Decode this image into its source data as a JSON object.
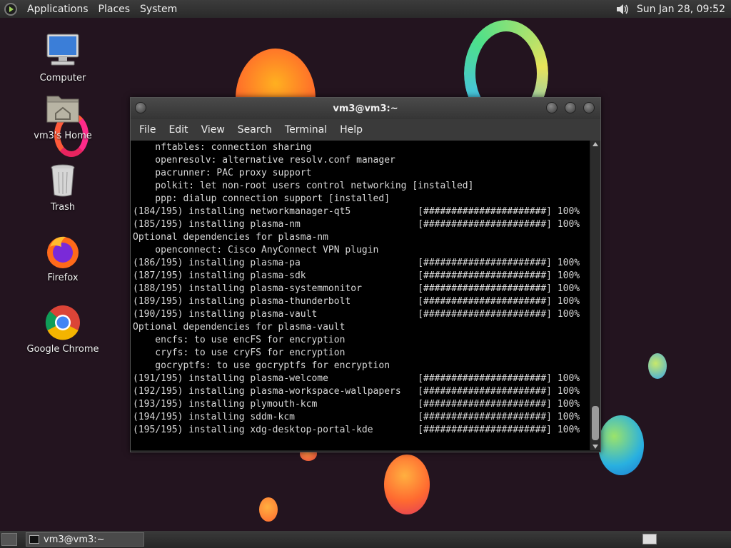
{
  "top_panel": {
    "menus": [
      "Applications",
      "Places",
      "System"
    ],
    "clock": "Sun Jan 28, 09:52",
    "icons": [
      "distro-logo-icon",
      "volume-icon"
    ]
  },
  "desktop_icons": [
    {
      "label": "Computer",
      "icon": "computer-icon"
    },
    {
      "label": "vm3's Home",
      "icon": "home-folder-icon"
    },
    {
      "label": "Trash",
      "icon": "trash-icon"
    },
    {
      "label": "Firefox",
      "icon": "firefox-icon"
    },
    {
      "label": "Google Chrome",
      "icon": "chrome-icon"
    }
  ],
  "terminal": {
    "title": "vm3@vm3:~",
    "menu": [
      "File",
      "Edit",
      "View",
      "Search",
      "Terminal",
      "Help"
    ],
    "lines": [
      "    nftables: connection sharing",
      "    openresolv: alternative resolv.conf manager",
      "    pacrunner: PAC proxy support",
      "    polkit: let non-root users control networking [installed]",
      "    ppp: dialup connection support [installed]",
      "(184/195) installing networkmanager-qt5            [######################] 100%",
      "(185/195) installing plasma-nm                     [######################] 100%",
      "Optional dependencies for plasma-nm",
      "    openconnect: Cisco AnyConnect VPN plugin",
      "(186/195) installing plasma-pa                     [######################] 100%",
      "(187/195) installing plasma-sdk                    [######################] 100%",
      "(188/195) installing plasma-systemmonitor          [######################] 100%",
      "(189/195) installing plasma-thunderbolt            [######################] 100%",
      "(190/195) installing plasma-vault                  [######################] 100%",
      "Optional dependencies for plasma-vault",
      "    encfs: to use encFS for encryption",
      "    cryfs: to use cryFS for encryption",
      "    gocryptfs: to use gocryptfs for encryption",
      "(191/195) installing plasma-welcome                [######################] 100%",
      "(192/195) installing plasma-workspace-wallpapers   [######################] 100%",
      "(193/195) installing plymouth-kcm                  [######################] 100%",
      "(194/195) installing sddm-kcm                      [######################] 100%",
      "(195/195) installing xdg-desktop-portal-kde        [######################] 100%"
    ]
  },
  "taskbar": {
    "window_label": "vm3@vm3:~"
  }
}
